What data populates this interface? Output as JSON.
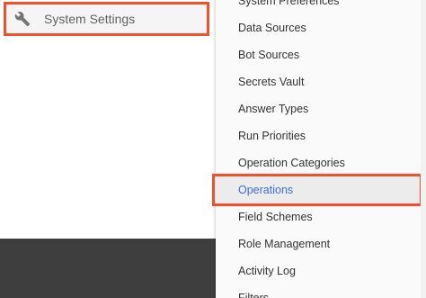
{
  "sidebar": {
    "item": {
      "label": "System Settings",
      "icon": "wrench-icon"
    }
  },
  "menu": {
    "items": [
      {
        "label": "System Preferences"
      },
      {
        "label": "Data Sources"
      },
      {
        "label": "Bot Sources"
      },
      {
        "label": "Secrets Vault"
      },
      {
        "label": "Answer Types"
      },
      {
        "label": "Run Priorities"
      },
      {
        "label": "Operation Categories"
      },
      {
        "label": "Operations"
      },
      {
        "label": "Field Schemes"
      },
      {
        "label": "Role Management"
      },
      {
        "label": "Activity Log"
      },
      {
        "label": "Filters"
      }
    ],
    "selected_label": "Operations"
  },
  "colors": {
    "highlight_border": "#f0502c",
    "selected_text": "#3f6ed6",
    "footer": "#3e3e3e"
  }
}
